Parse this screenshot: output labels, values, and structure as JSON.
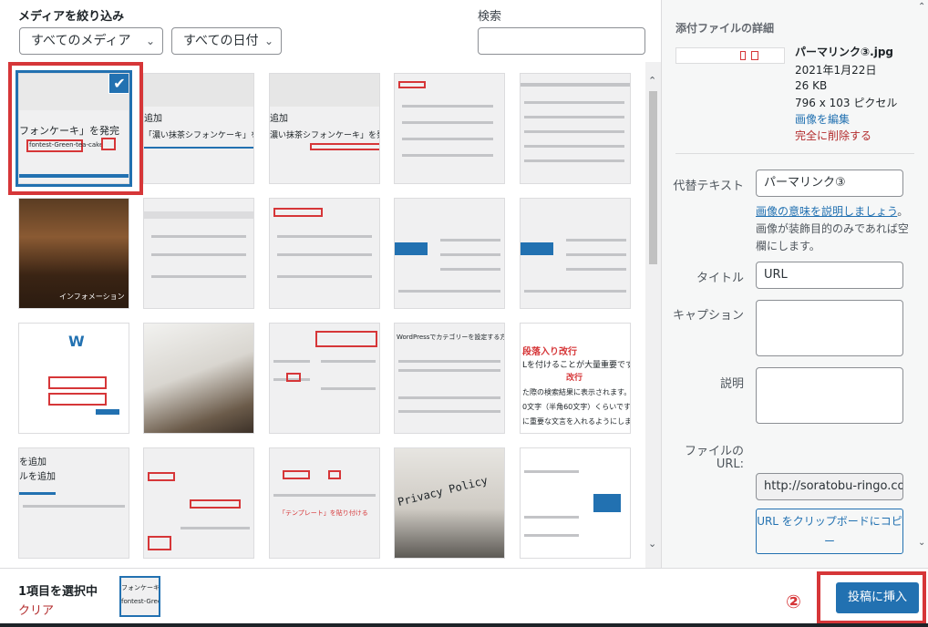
{
  "filter": {
    "title": "メディアを絞り込み",
    "media_select": "すべてのメディア",
    "date_select": "すべての日付",
    "search_label": "検索",
    "search_value": ""
  },
  "thumbs": {
    "selected_text_1": "フォンケーキ」を発完",
    "selected_text_2": "fontest-Green-tea-cake",
    "thumb2_text_1": "追加",
    "thumb2_text_2": "「濃い抹茶シフォンケーキ」を発完",
    "thumb3_text_1": "追加",
    "thumb3_text_2": "濃い抹茶シフォンケーキ」を発完",
    "cafe_text": "インフォメーション",
    "wp_text": "W",
    "blog_row3_title": "WordPressでカテゴリーを設定する方法",
    "paragraph_title": "段落入り改行",
    "paragraph_text_1": "Lを付けることが大量重要です",
    "paragraph_text_2": "改行",
    "paragraph_text_3": "た際の検索結果に表示されます。そ",
    "paragraph_text_4": "0文字（半角60文字）くらいです。タ",
    "paragraph_text_5": "に重要な文言を入れるようにしましょ",
    "row4_text_1": "を追加",
    "row4_text_2": "ルを追加",
    "template_text": "「テンプレート」を貼り付ける",
    "privacy_text": "Privacy Policy"
  },
  "details": {
    "title": "添付ファイルの詳細",
    "filename": "パーマリンク③.jpg",
    "date": "2021年1月22日",
    "size": "26 KB",
    "dimensions": "796 x 103 ピクセル",
    "edit_link": "画像を編集",
    "delete_link": "完全に削除する",
    "alt_label": "代替テキスト",
    "alt_value": "パーマリンク③",
    "help_link": "画像の意味を説明しましょう",
    "help_text": "。画像が装飾目的のみであれば空欄にします。",
    "title_label": "タイトル",
    "title_value": "URL",
    "caption_label": "キャプション",
    "caption_value": "",
    "description_label": "説明",
    "description_value": "",
    "file_url_label_1": "ファイルの",
    "file_url_label_2": "URL:",
    "file_url_value": "http://soratobu-ringo.com",
    "copy_button": "URL をクリップボードにコピー"
  },
  "toolbar": {
    "selected_count": "1項目を選択中",
    "clear": "クリア",
    "step_marker": "②",
    "insert_button": "投稿に挿入"
  },
  "colors": {
    "accent": "#2271b1",
    "annotation_red": "#d63638",
    "delete_red": "#b32d2e"
  }
}
